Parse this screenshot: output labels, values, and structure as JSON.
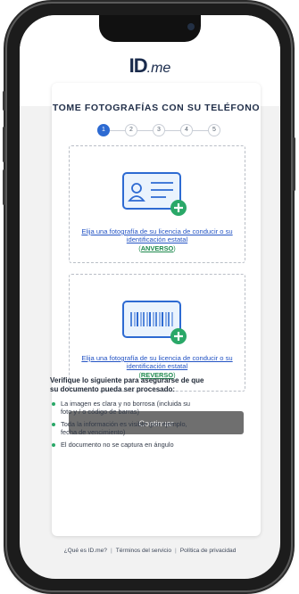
{
  "brand": {
    "id": "ID",
    "me": ".me"
  },
  "title": "TOME FOTOGRAFÍAS CON SU TELÉFONO",
  "steps": [
    "1",
    "2",
    "3",
    "4",
    "5"
  ],
  "upload_front": {
    "link_text": "Elija una fotografía de su licencia de conducir o su identificación estatal",
    "tag_open": "(",
    "tag_label": "ANVERSO",
    "tag_close": ")"
  },
  "upload_back": {
    "link_text": "Elija una fotografía de su licencia de conducir o su identificación estatal",
    "tag_open": "(",
    "tag_label": "REVERSO",
    "tag_close": ")"
  },
  "continue_label": "Continuar",
  "verify_heading": "Verifique lo siguiente para asegurarse de que su documento pueda ser procesado:",
  "checklist": [
    "La imagen es clara y no borrosa (incluida su foto y / o código de barras)",
    "Toda la información es visible (por ejemplo, fecha de vencimiento)",
    "El documento no se captura en ángulo"
  ],
  "footer": {
    "what": "¿Qué es ID.me?",
    "terms": "Términos del servicio",
    "privacy": "Política de privacidad",
    "separator": "|"
  },
  "colors": {
    "primary": "#2d6ad2",
    "link": "#2454c4",
    "accent_green": "#2aa868",
    "button_disabled": "#6f6f6f"
  }
}
